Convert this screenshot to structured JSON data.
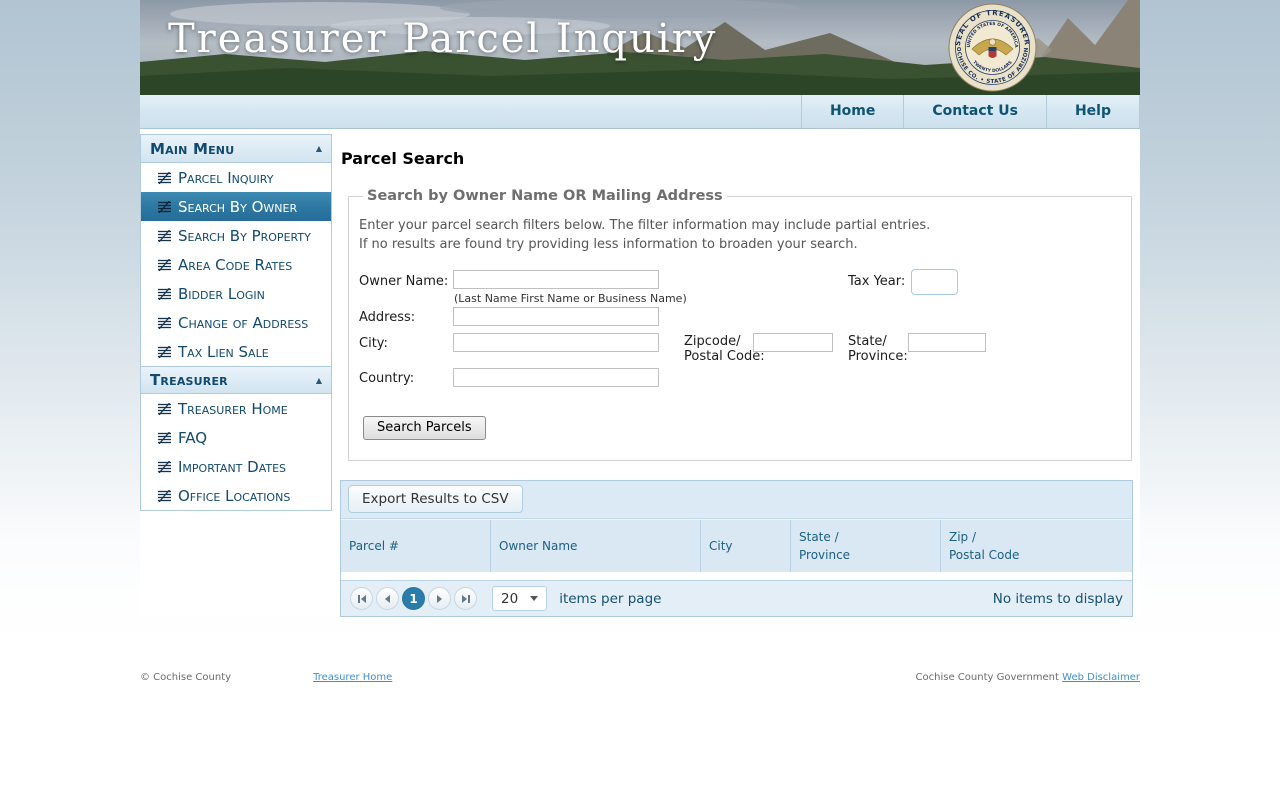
{
  "colors": {
    "selected_item_bg": "#2d77a2",
    "nav_text": "#0d5373",
    "sidebar_text": "#12496e",
    "grid_header_text": "#1d5f82",
    "pager_text": "#16506e",
    "current_page_bg": "#2a7cab",
    "link": "#3d8fd1",
    "toolbar_bg": "#dceaf5"
  },
  "banner": {
    "title": "Treasurer Parcel Inquiry",
    "seal": {
      "outer_top": "SEAL OF TREASURER",
      "outer_bottom": "COCHISE CO. • STATE OF ARIZONA",
      "inner_top": "UNITED STATES OF AMERICA",
      "inner_bottom": "TWENTY DOLLARS"
    }
  },
  "nav": {
    "home": "Home",
    "contact": "Contact Us",
    "help": "Help"
  },
  "sidebar": {
    "group1": {
      "header": "Main Menu",
      "items": [
        "Parcel Inquiry",
        "Search By Owner",
        "Search By Property",
        "Area Code Rates",
        "Bidder Login",
        "Change of Address",
        "Tax Lien Sale"
      ]
    },
    "group2": {
      "header": "Treasurer",
      "items": [
        "Treasurer Home",
        "FAQ",
        "Important Dates",
        "Office Locations"
      ]
    }
  },
  "main": {
    "title": "Parcel Search",
    "panel": {
      "legend": "Search by Owner Name OR Mailing Address",
      "line1": "Enter your parcel search filters below. The filter information may include partial entries.",
      "line2": "If no results are found try providing less information to broaden your search.",
      "owner_label": "Owner Name:",
      "owner_hint": "(Last Name First Name or Business Name)",
      "tax_year_label": "Tax Year:",
      "address_label": "Address:",
      "city_label": "City:",
      "zip_label_1": "Zipcode/",
      "zip_label_2": "Postal Code:",
      "state_label_1": "State/",
      "state_label_2": "Province:",
      "country_label": "Country:",
      "search_button": "Search Parcels"
    },
    "grid": {
      "export_button": "Export Results to CSV",
      "col_parcel": "Parcel #",
      "col_owner": "Owner Name",
      "col_city": "City",
      "col_state_1": "State /",
      "col_state_2": "Province",
      "col_zip_1": "Zip /",
      "col_zip_2": "Postal Code",
      "pager": {
        "current_page": "1",
        "page_size": "20",
        "items_per_page": "items per page",
        "status": "No items to display"
      }
    }
  },
  "footer": {
    "copyright": "© Cochise County",
    "treasurer_home_link": "Treasurer Home",
    "government_text": "Cochise County Government",
    "disclaimer_link": "Web Disclaimer"
  }
}
